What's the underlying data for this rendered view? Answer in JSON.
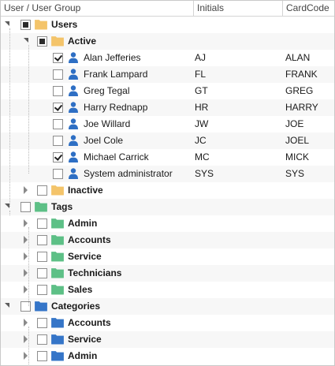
{
  "columns": {
    "name": "User / User Group",
    "initials": "Initials",
    "cardcode": "CardCode"
  },
  "colors": {
    "folder_orange": "#f3c46a",
    "folder_green": "#5dbf86",
    "folder_blue": "#3576c8",
    "user_icon": "#2e6fc4"
  },
  "groups": {
    "users": "Users",
    "active": "Active",
    "inactive": "Inactive",
    "tags": "Tags",
    "categories": "Categories"
  },
  "users": [
    {
      "name": "Alan Jefferies",
      "initials": "AJ",
      "cardcode": "ALAN",
      "checked": true
    },
    {
      "name": "Frank Lampard",
      "initials": "FL",
      "cardcode": "FRANK",
      "checked": false
    },
    {
      "name": "Greg Tegal",
      "initials": "GT",
      "cardcode": "GREG",
      "checked": false
    },
    {
      "name": "Harry Rednapp",
      "initials": "HR",
      "cardcode": "HARRY",
      "checked": true
    },
    {
      "name": "Joe Willard",
      "initials": "JW",
      "cardcode": "JOE",
      "checked": false
    },
    {
      "name": "Joel Cole",
      "initials": "JC",
      "cardcode": "JOEL",
      "checked": false
    },
    {
      "name": "Michael Carrick",
      "initials": "MC",
      "cardcode": "MICK",
      "checked": true
    },
    {
      "name": "System administrator",
      "initials": "SYS",
      "cardcode": "SYS",
      "checked": false
    }
  ],
  "tags": [
    "Admin",
    "Accounts",
    "Service",
    "Technicians",
    "Sales"
  ],
  "categories": [
    "Accounts",
    "Service",
    "Admin"
  ]
}
